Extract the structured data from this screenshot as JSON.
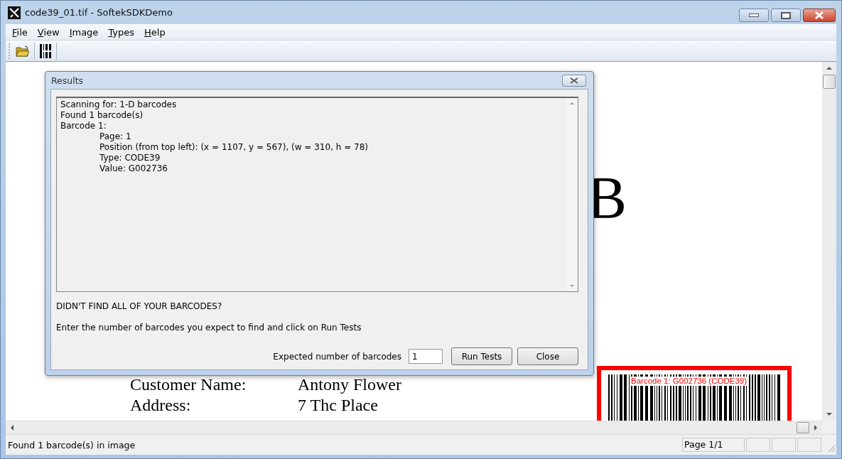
{
  "window": {
    "title": "code39_01.tif - SoftekSDKDemo"
  },
  "menu": [
    {
      "label": "File"
    },
    {
      "label": "View"
    },
    {
      "label": "Image"
    },
    {
      "label": "Types"
    },
    {
      "label": "Help"
    }
  ],
  "document": {
    "heading_fragment": "B",
    "form": [
      {
        "label": "Customer Name:",
        "value": "Antony Flower"
      },
      {
        "label": "Address:",
        "value": "7 Thc Place"
      }
    ],
    "barcode": {
      "label": "Barcode 1: G002736 (CODE39)",
      "color": "#ff0000"
    }
  },
  "dialog": {
    "title": "Results",
    "results": [
      {
        "text": "Scanning for: 1-D barcodes"
      },
      {
        "text": "Found 1 barcode(s)"
      },
      {
        "text": "Barcode 1:",
        "children": [
          {
            "text": "Page: 1"
          },
          {
            "text": "Position (from top left): (x = 1107, y = 567), (w = 310, h = 78)"
          },
          {
            "text": "Type: CODE39"
          },
          {
            "text": "Value: G002736"
          }
        ]
      }
    ],
    "prompt": "DIDN'T FIND ALL OF YOUR BARCODES?",
    "instruction": "Enter the number of barcodes you expect to find and click on Run Tests",
    "expected_label": "Expected number of barcodes",
    "expected_value": "1",
    "buttons": [
      {
        "label": "Run Tests"
      },
      {
        "label": "Close"
      }
    ]
  },
  "status_bar": {
    "message": "Found 1 barcode(s) in image",
    "page": "Page 1/1"
  }
}
